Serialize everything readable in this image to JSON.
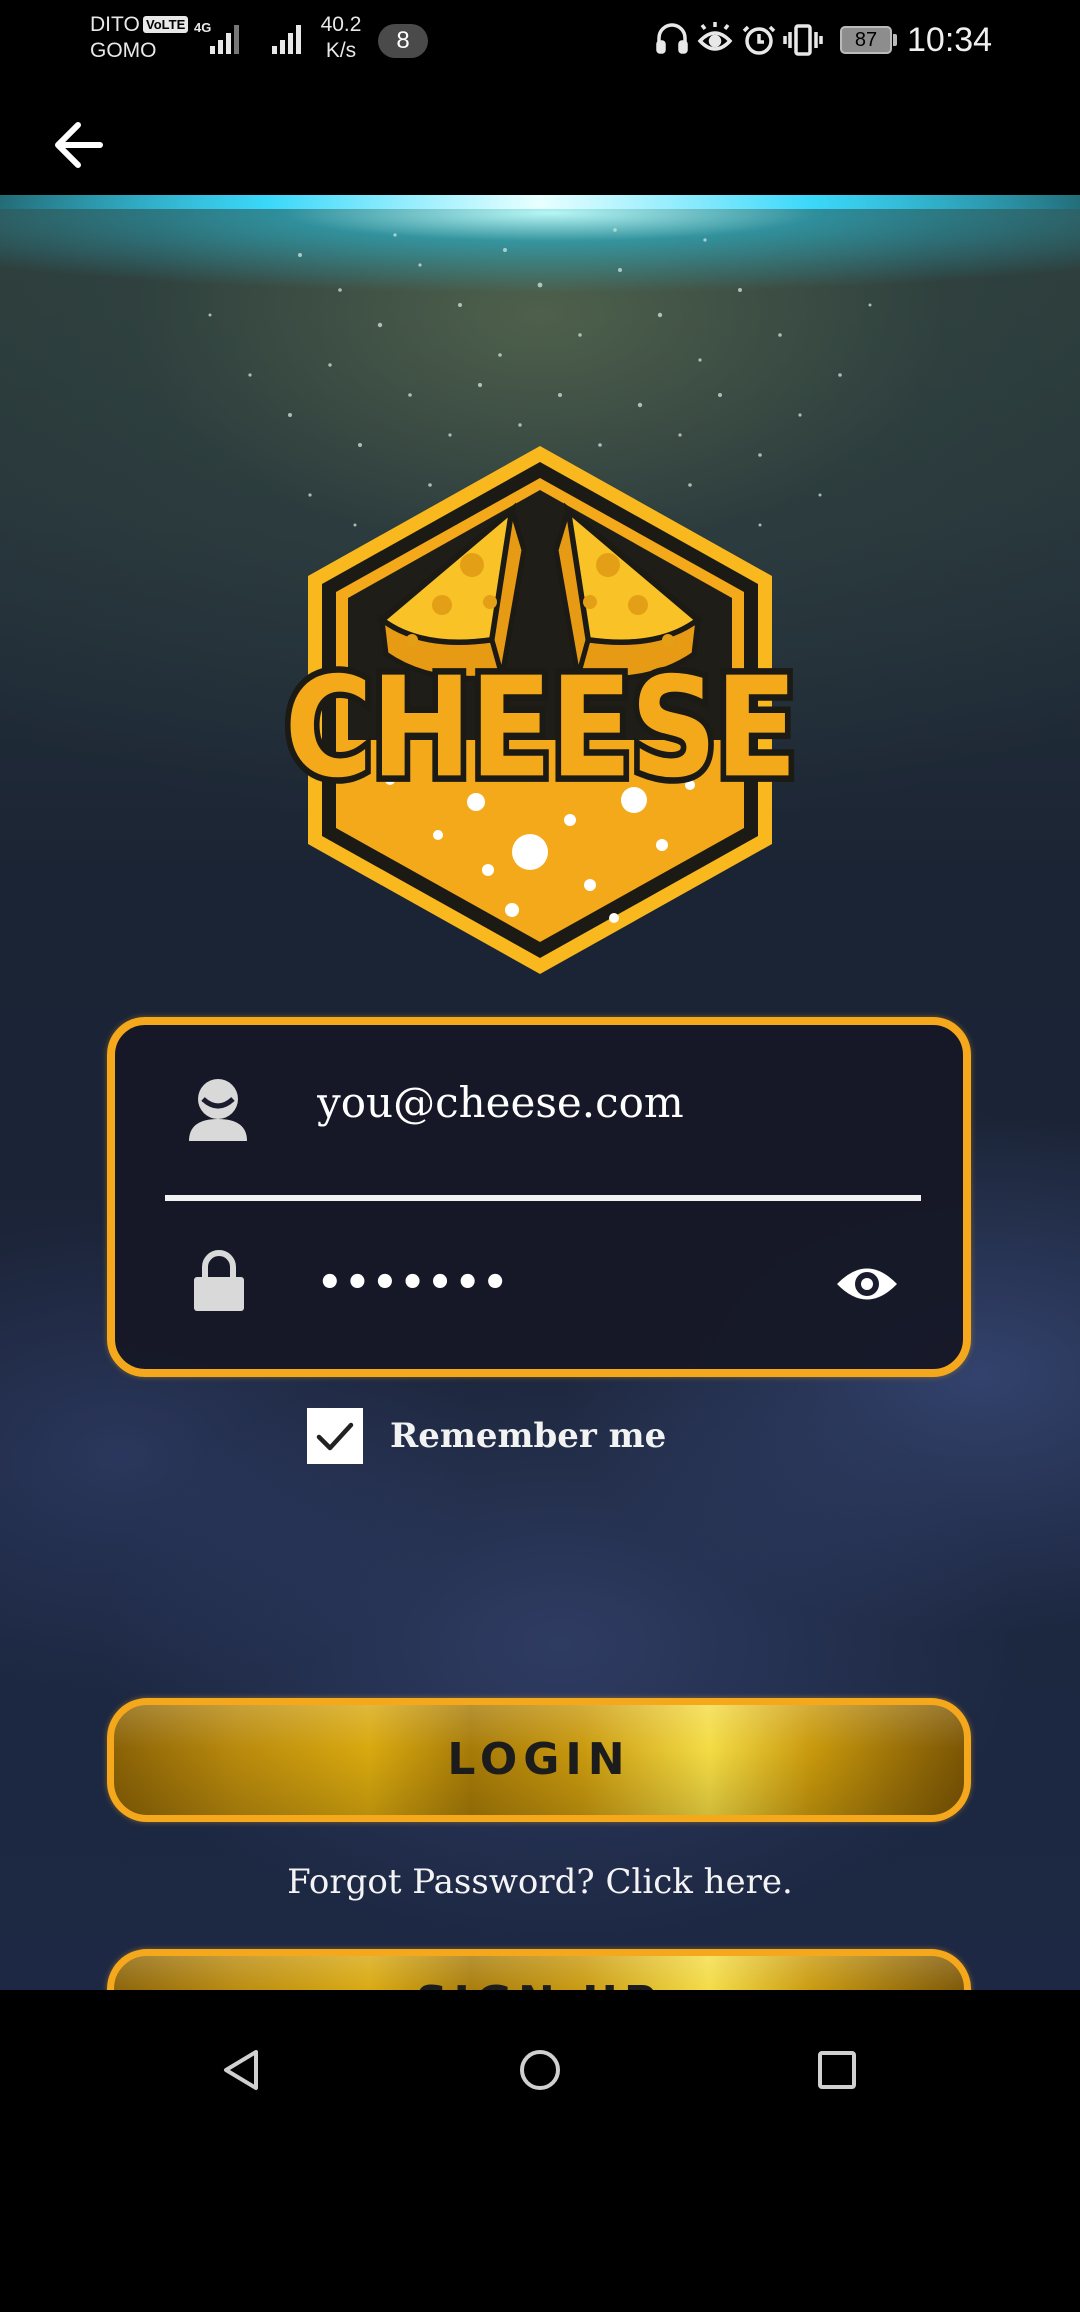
{
  "status_bar": {
    "carrier_line1": "DITO",
    "carrier_line2": "GOMO",
    "volte": "VoLTE",
    "network": "4G",
    "speed_value": "40.2",
    "speed_unit": "K/s",
    "notification_count": "8",
    "icons": [
      "headphones-icon",
      "eye-comfort-icon",
      "alarm-icon",
      "vibrate-icon"
    ],
    "battery_percent": "87",
    "time": "10:34"
  },
  "app_bar": {
    "back_icon": "arrow-left-icon"
  },
  "logo": {
    "text": "CHEESE"
  },
  "login_form": {
    "email_value": "you@cheese.com",
    "email_icon": "user-icon",
    "password_value": "•••••••",
    "password_icon": "lock-icon",
    "visibility_icon": "eye-icon",
    "remember_me_label": "Remember me",
    "remember_me_checked": true,
    "login_label": "LOGIN",
    "forgot_password_text": "Forgot Password? Click here.",
    "signup_label": "SIGN UP"
  },
  "navigation_bar": {
    "back": "triangle-back-icon",
    "home": "circle-home-icon",
    "recents": "square-recents-icon"
  },
  "colors": {
    "accent_orange": "#f5a81c",
    "gold_light": "#f4dc45",
    "gold_dark": "#8a6206",
    "card_bg": "#16182a",
    "logo_dark": "#1b1a14",
    "logo_yellow": "#f9b81e"
  }
}
